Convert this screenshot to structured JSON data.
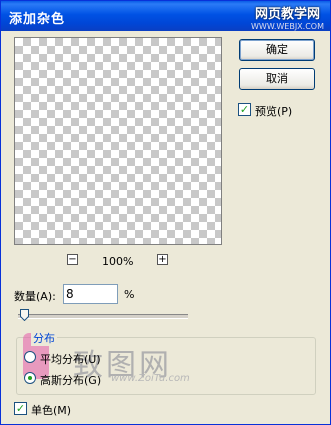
{
  "window": {
    "title": "添加杂色",
    "close_glyph": "×"
  },
  "watermark_top": {
    "line1": "网页教学网",
    "line2": "WWW.WEBJX.COM"
  },
  "buttons": {
    "ok": "确定",
    "cancel": "取消"
  },
  "preview_checkbox": {
    "label": "预览(P)",
    "checked": true,
    "check_glyph": "✓"
  },
  "zoom": {
    "minus": "−",
    "plus": "+",
    "level": "100%"
  },
  "amount": {
    "label": "数量(A):",
    "value": "8",
    "unit": "%",
    "slider_fraction": 0.01
  },
  "distribution": {
    "title": "分布",
    "options": [
      {
        "label": "平均分布(U)",
        "selected": false
      },
      {
        "label": "高斯分布(G)",
        "selected": true
      }
    ]
  },
  "monochrome": {
    "label": "单色(M)",
    "checked": true,
    "check_glyph": "✓"
  },
  "watermark_logo": {
    "text": "致图网",
    "url": "www.ZoiTu.com"
  },
  "colors": {
    "title_bar": "#0054e3",
    "dialog_bg": "#ece9d8",
    "check_green": "#21a121",
    "group_title": "#0046d5"
  }
}
